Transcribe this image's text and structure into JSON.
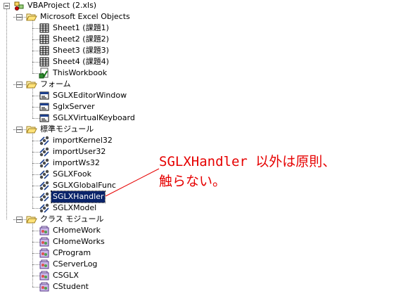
{
  "tree": {
    "root_label": "VBAProject (2.xls)",
    "folders": [
      {
        "label": "Microsoft Excel Objects",
        "items": [
          {
            "label": "Sheet1 (課題1)",
            "icon": "worksheet-icon"
          },
          {
            "label": "Sheet2 (課題2)",
            "icon": "worksheet-icon"
          },
          {
            "label": "Sheet3 (課題3)",
            "icon": "worksheet-icon"
          },
          {
            "label": "Sheet4 (課題4)",
            "icon": "worksheet-icon"
          },
          {
            "label": "ThisWorkbook",
            "icon": "workbook-icon"
          }
        ]
      },
      {
        "label": "フォーム",
        "items": [
          {
            "label": "SGLXEditorWindow",
            "icon": "userform-icon"
          },
          {
            "label": "SglxServer",
            "icon": "userform-icon"
          },
          {
            "label": "SGLXVirtualKeyboard",
            "icon": "userform-icon"
          }
        ]
      },
      {
        "label": "標準モジュール",
        "items": [
          {
            "label": "importKernel32",
            "icon": "module-icon"
          },
          {
            "label": "importUser32",
            "icon": "module-icon"
          },
          {
            "label": "importWs32",
            "icon": "module-icon"
          },
          {
            "label": "SGLXFook",
            "icon": "module-icon"
          },
          {
            "label": "SGLXGlobalFunc",
            "icon": "module-icon"
          },
          {
            "label": "SGLXHandler",
            "icon": "module-icon",
            "selected": true
          },
          {
            "label": "SGLXModel",
            "icon": "module-icon"
          }
        ]
      },
      {
        "label": "クラス モジュール",
        "items": [
          {
            "label": "CHomeWork",
            "icon": "class-module-icon"
          },
          {
            "label": "CHomeWorks",
            "icon": "class-module-icon"
          },
          {
            "label": "CProgram",
            "icon": "class-module-icon"
          },
          {
            "label": "CServerLog",
            "icon": "class-module-icon"
          },
          {
            "label": "CSGLX",
            "icon": "class-module-icon"
          },
          {
            "label": "CStudent",
            "icon": "class-module-icon"
          }
        ]
      }
    ]
  },
  "annotation": {
    "text": "SGLXHandler 以外は原則、\n触らない。",
    "color": "#e60000"
  }
}
